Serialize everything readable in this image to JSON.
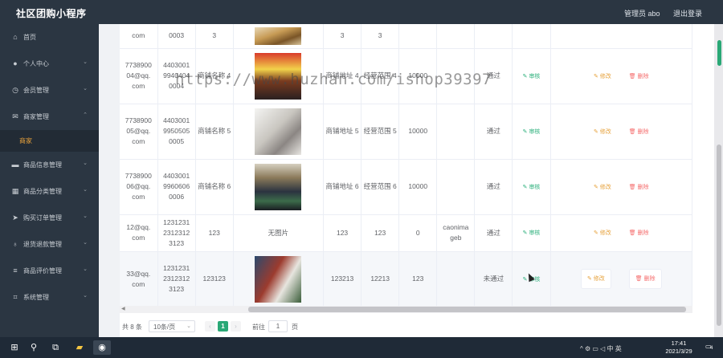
{
  "header": {
    "app_title": "社区团购小程序",
    "admin_label": "管理员 abo",
    "logout_label": "退出登录"
  },
  "sidebar": {
    "items": [
      {
        "label": "首页",
        "icon": "home-icon",
        "glyph": "⌂",
        "arrow": ""
      },
      {
        "label": "个人中心",
        "icon": "user-icon",
        "glyph": "●",
        "arrow": "⌄"
      },
      {
        "label": "会员管理",
        "icon": "clock-icon",
        "glyph": "◷",
        "arrow": "⌄"
      },
      {
        "label": "商家管理",
        "icon": "mail-icon",
        "glyph": "✉",
        "arrow": "⌃"
      },
      {
        "label": "商品信息管理",
        "icon": "monitor-icon",
        "glyph": "▬",
        "arrow": "⌄"
      },
      {
        "label": "商品分类管理",
        "icon": "grid-icon",
        "glyph": "▦",
        "arrow": "⌄"
      },
      {
        "label": "购买订单管理",
        "icon": "send-icon",
        "glyph": "➤",
        "arrow": "⌄"
      },
      {
        "label": "退货退款管理",
        "icon": "bulb-icon",
        "glyph": "♁",
        "arrow": "⌄"
      },
      {
        "label": "商品评价管理",
        "icon": "list-icon",
        "glyph": "≡",
        "arrow": "⌄"
      },
      {
        "label": "系统管理",
        "icon": "crop-icon",
        "glyph": "⌗",
        "arrow": "⌄"
      }
    ],
    "submenu": {
      "label": "商家"
    }
  },
  "table": {
    "rows": [
      {
        "email": "com",
        "phone": "0003",
        "shop_name": "3",
        "image": "img-a",
        "image_text": "",
        "address": "3",
        "scope": "3",
        "amount": "",
        "note": "",
        "status": "",
        "short": true
      },
      {
        "email": "7738900 04@qq. com",
        "phone": "4403001 9940404 0004",
        "shop_name": "商铺名称 4",
        "image": "img-b",
        "image_text": "",
        "address": "商铺地址 4",
        "scope": "经营范围 4",
        "amount": "10000",
        "note": "",
        "status": "通过"
      },
      {
        "email": "7738900 05@qq. com",
        "phone": "4403001 9950505 0005",
        "shop_name": "商铺名称 5",
        "image": "img-c",
        "image_text": "",
        "address": "商铺地址 5",
        "scope": "经营范围 5",
        "amount": "10000",
        "note": "",
        "status": "通过"
      },
      {
        "email": "7738900 06@qq. com",
        "phone": "4403001 9960606 0006",
        "shop_name": "商铺名称 6",
        "image": "img-d",
        "image_text": "",
        "address": "商铺地址 6",
        "scope": "经营范围 6",
        "amount": "10000",
        "note": "",
        "status": "通过"
      },
      {
        "email": "12@qq. com",
        "phone": "1231231 2312312 3123",
        "shop_name": "123",
        "image": "",
        "image_text": "无图片",
        "address": "123",
        "scope": "123",
        "amount": "0",
        "note": "caonima geb",
        "status": "通过"
      },
      {
        "email": "33@qq. com",
        "phone": "1231231 2312312 3123",
        "shop_name": "123123",
        "image": "img-e",
        "image_text": "",
        "address": "123213",
        "scope": "12213",
        "amount": "123",
        "note": "",
        "status": "未通过",
        "highlight": true
      }
    ],
    "actions": {
      "audit": "审核",
      "edit": "修改",
      "delete": "删除"
    }
  },
  "pagination": {
    "total": "共 8 条",
    "page_size": "10条/页",
    "current_page": "1",
    "goto_prefix": "前往",
    "goto_value": "1",
    "goto_suffix": "页"
  },
  "watermark": "https://www.huzhan.com/ishop39397",
  "taskbar": {
    "clock_time": "17:41",
    "clock_date": "2021/3/29",
    "tray_text": "^ ⚙ ▭ ◁ 中 英",
    "notification_count": "4"
  },
  "colors": {
    "brand_dark": "#2b3642",
    "accent_green": "#2aa876",
    "edit_orange": "#e6a23c",
    "delete_red": "#f56c6c"
  }
}
